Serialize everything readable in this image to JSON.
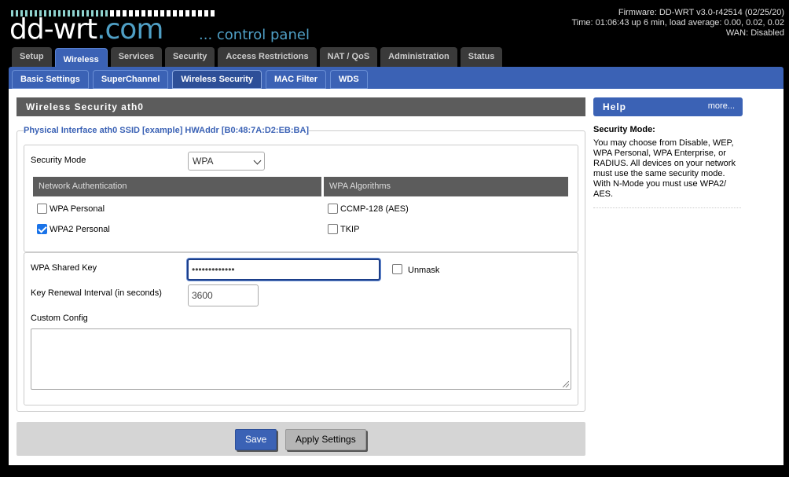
{
  "header": {
    "logo_main": "dd-wrt",
    "logo_suffix": ".com",
    "control_panel": "... control panel",
    "firmware": "Firmware: DD-WRT v3.0-r42514 (02/25/20)",
    "time": "Time: 01:06:43 up 6 min, load average: 0.00, 0.02, 0.02",
    "wan": "WAN: Disabled"
  },
  "main_tabs": [
    "Setup",
    "Wireless",
    "Services",
    "Security",
    "Access Restrictions",
    "NAT / QoS",
    "Administration",
    "Status"
  ],
  "main_tab_active": "Wireless",
  "sub_tabs": [
    "Basic Settings",
    "SuperChannel",
    "Wireless Security",
    "MAC Filter",
    "WDS"
  ],
  "sub_tab_active": "Wireless Security",
  "section_title": "Wireless Security ath0",
  "interface_legend": "Physical Interface ath0 SSID [example] HWAddr [B0:48:7A:D2:EB:BA]",
  "security_mode": {
    "label": "Security Mode",
    "value": "WPA"
  },
  "network_auth": {
    "header": "Network Authentication",
    "options": [
      {
        "label": "WPA Personal",
        "checked": false
      },
      {
        "label": "WPA2 Personal",
        "checked": true
      }
    ]
  },
  "wpa_algorithms": {
    "header": "WPA Algorithms",
    "options": [
      {
        "label": "CCMP-128 (AES)",
        "checked": false
      },
      {
        "label": "TKIP",
        "checked": false
      }
    ]
  },
  "shared_key": {
    "label": "WPA Shared Key",
    "value": "•••••••••••••",
    "unmask_label": "Unmask",
    "unmask_checked": false
  },
  "key_renewal": {
    "label": "Key Renewal Interval (in seconds)",
    "value": "3600"
  },
  "custom_config": {
    "label": "Custom Config",
    "value": ""
  },
  "buttons": {
    "save": "Save",
    "apply": "Apply Settings"
  },
  "help": {
    "title": "Help",
    "more": "more...",
    "heading": "Security Mode:",
    "body": "You may choose from Disable, WEP, WPA Personal, WPA Enterprise, or RADIUS. All devices on your network must use the same security mode. With N-Mode you must use WPA2/ AES."
  },
  "colors": {
    "accent": "#3b62b5",
    "section_header": "#5c5c5c",
    "logo_teal": "#8fd3cf",
    "checkbox_on": "#1a73e8"
  }
}
